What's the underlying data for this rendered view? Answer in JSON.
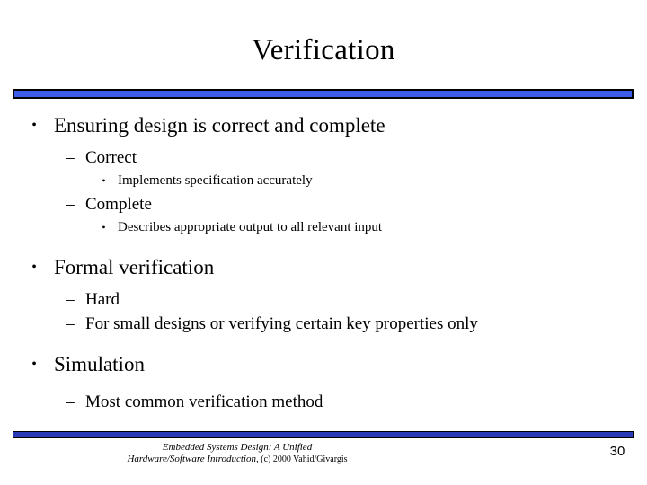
{
  "slide": {
    "title": "Verification",
    "page_number": "30",
    "accent_color_top": "#3d5ce8",
    "accent_color_bottom": "#2b3ab6",
    "border_color": "#000000",
    "background_color": "#ffffff"
  },
  "bullets": [
    {
      "level": 1,
      "marker": "•",
      "text": "Ensuring design is correct and complete"
    },
    {
      "level": 2,
      "marker": "–",
      "text": "Correct"
    },
    {
      "level": 3,
      "marker": "•",
      "text": "Implements specification accurately"
    },
    {
      "level": 2,
      "marker": "–",
      "text": "Complete"
    },
    {
      "level": 3,
      "marker": "•",
      "text": "Describes appropriate output to all relevant input"
    },
    {
      "level": 1,
      "marker": "•",
      "text": "Formal verification"
    },
    {
      "level": 2,
      "marker": "–",
      "text": "Hard"
    },
    {
      "level": 2,
      "marker": "–",
      "text": "For small designs or verifying certain key properties only"
    },
    {
      "level": 1,
      "marker": "•",
      "text": "Simulation"
    },
    {
      "level": 2,
      "marker": "–",
      "text": "Most common verification method"
    }
  ],
  "footer": {
    "line1": "Embedded Systems Design: A Unified",
    "line2_title": "Hardware/Software Introduction,",
    "line2_copyright": " (c) 2000 Vahid/Givargis"
  }
}
